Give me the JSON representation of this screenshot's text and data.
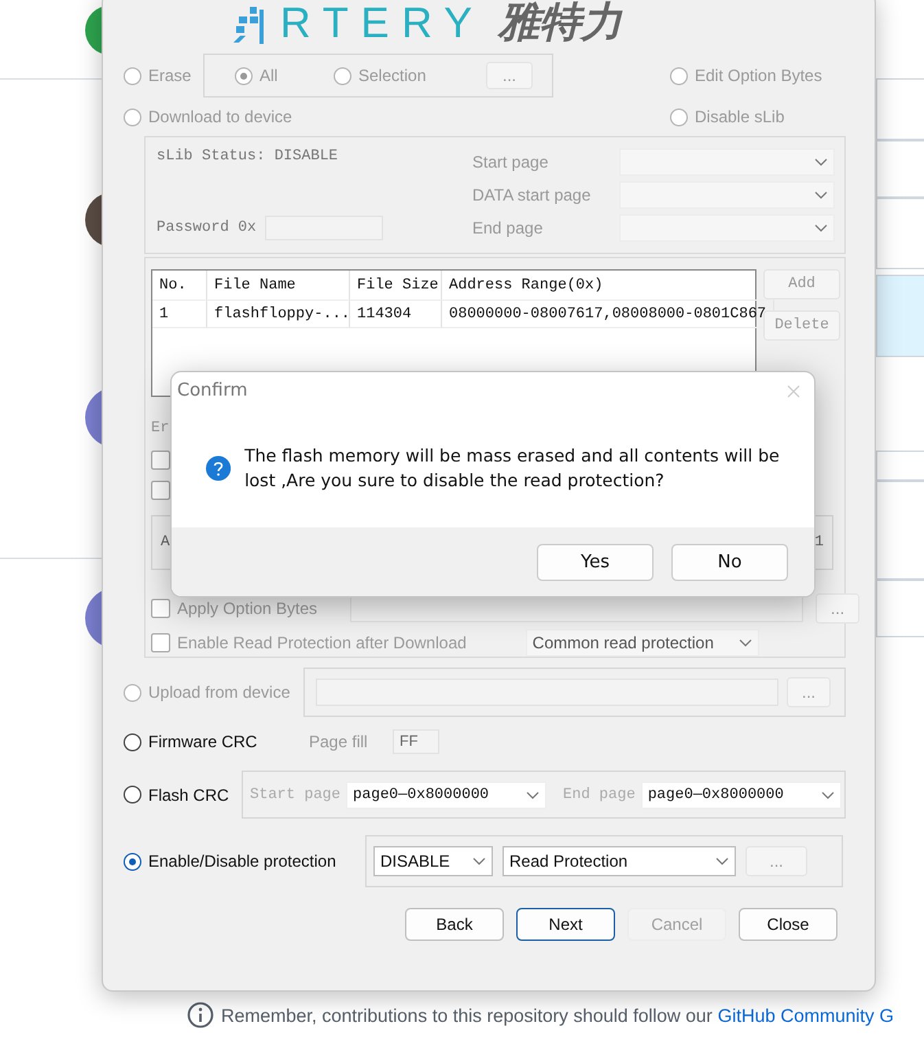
{
  "logo": {
    "wordmark": "RTERY",
    "chinese": "雅特力"
  },
  "erase": {
    "label": "Erase",
    "selected": false,
    "disabled": true,
    "scope": [
      {
        "label": "All",
        "selected": true
      },
      {
        "label": "Selection",
        "selected": false
      }
    ],
    "browse": "..."
  },
  "edit_option_bytes": {
    "label": "Edit Option Bytes",
    "selected": false,
    "disabled": true
  },
  "download": {
    "label": "Download to device",
    "selected": false,
    "disabled": true
  },
  "disable_slib": {
    "label": "Disable sLib",
    "selected": false,
    "disabled": true
  },
  "slib": {
    "status": "sLib Status: DISABLE",
    "password_label": "Password 0x",
    "fields": [
      {
        "label": "Start page"
      },
      {
        "label": "DATA start page"
      },
      {
        "label": "End page"
      }
    ]
  },
  "files": {
    "columns": [
      "No.",
      "File Name",
      "File Size",
      "Address Range(0x)"
    ],
    "rows": [
      [
        "1",
        "flashfloppy-...",
        "114304",
        "08000000-08007617,08008000-0801C867"
      ]
    ],
    "buttons": [
      {
        "label": "Add"
      },
      {
        "label": "Delete"
      }
    ]
  },
  "download_settings": {
    "section_label": "Er",
    "checkboxes": [
      {
        "checked": false
      },
      {
        "checked": false
      }
    ],
    "address_label": "A",
    "address_value": "1",
    "apply_option_bytes": {
      "label": "Apply Option Bytes",
      "checked": false,
      "browse": "..."
    },
    "read_protection": {
      "label": "Enable Read Protection after Download",
      "checked": false,
      "mode": "Common read protection"
    }
  },
  "upload": {
    "label": "Upload from device",
    "selected": false,
    "disabled": true,
    "browse": "..."
  },
  "firmware_crc": {
    "label": "Firmware CRC",
    "selected": false,
    "disabled": false,
    "page_fill_label": "Page fill",
    "page_fill": "FF"
  },
  "flash_crc": {
    "label": "Flash CRC",
    "selected": false,
    "disabled": false,
    "start_label": "Start page",
    "start": "page0—0x8000000",
    "end_label": "End page",
    "end": "page0—0x8000000"
  },
  "protection": {
    "label": "Enable/Disable protection",
    "selected": true,
    "disabled": false,
    "state": "DISABLE",
    "type": "Read Protection",
    "browse": "..."
  },
  "buttons": [
    {
      "label": "Back",
      "disabled": false,
      "default": false
    },
    {
      "label": "Next",
      "disabled": false,
      "default": true
    },
    {
      "label": "Cancel",
      "disabled": true,
      "default": false
    },
    {
      "label": "Close",
      "disabled": false,
      "default": false
    }
  ],
  "confirm": {
    "title": "Confirm",
    "message": "The flash memory will be mass erased and all contents will be lost ,Are you sure to disable the read protection?",
    "buttons": [
      {
        "label": "Yes"
      },
      {
        "label": "No"
      }
    ]
  },
  "footer": {
    "text": "Remember, contributions to this repository should follow our ",
    "link": "GitHub Community G"
  }
}
